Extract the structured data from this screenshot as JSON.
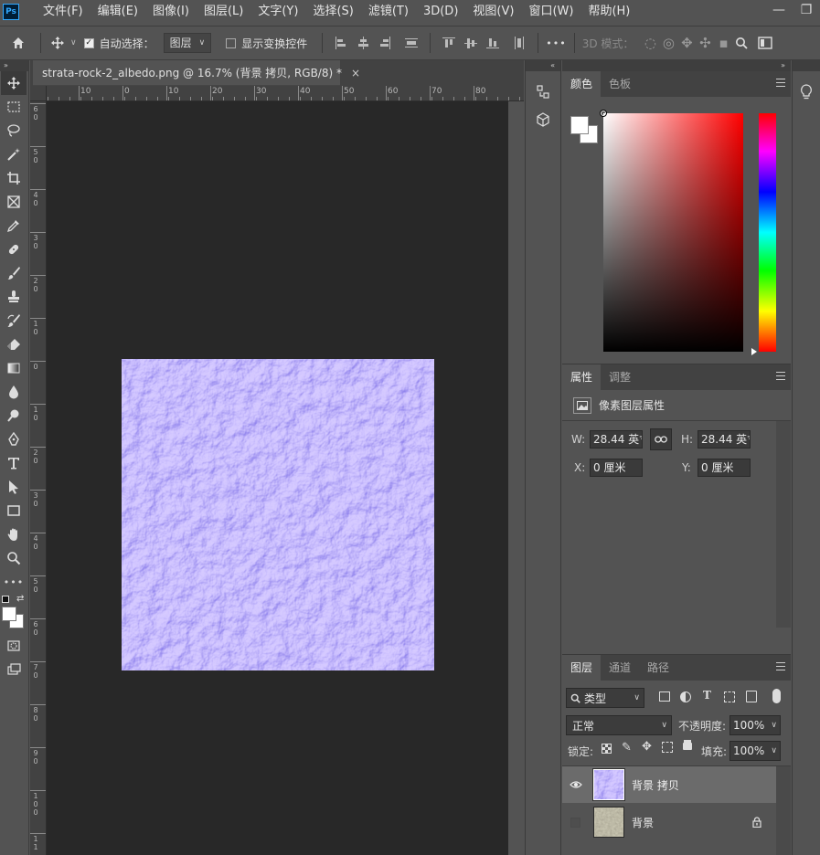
{
  "app": {
    "logo": "Ps",
    "menu": [
      "文件(F)",
      "编辑(E)",
      "图像(I)",
      "图层(L)",
      "文字(Y)",
      "选择(S)",
      "滤镜(T)",
      "3D(D)",
      "视图(V)",
      "窗口(W)",
      "帮助(H)"
    ],
    "window_controls": {
      "minimize": "—",
      "restore": "❐"
    }
  },
  "options": {
    "auto_select_label": "自动选择：",
    "auto_select_checked": true,
    "target_value": "图层",
    "show_transform_label": "显示变换控件",
    "show_transform_checked": false,
    "more": "•••",
    "mode_3d_label": "3D 模式："
  },
  "document": {
    "tab_title": "strata-rock-2_albedo.png @ 16.7% (背景 拷贝, RGB/8) *",
    "close_glyph": "×",
    "ruler_h_labels": [
      "10",
      "0",
      "10",
      "20",
      "30",
      "40",
      "50",
      "60",
      "70",
      "80"
    ],
    "ruler_v_labels": [
      "6\n0",
      "5\n0",
      "4\n0",
      "3\n0",
      "2\n0",
      "1\n0",
      "0",
      "1\n0",
      "2\n0",
      "3\n0",
      "4\n0",
      "5\n0",
      "6\n0",
      "7\n0",
      "8\n0",
      "9\n0",
      "1\n0\n0",
      "1\n1"
    ],
    "zoom": "16.7%"
  },
  "color_panel": {
    "tabs": [
      "颜色",
      "色板"
    ],
    "active_tab": 0,
    "foreground": "#ffffff",
    "background": "#ffffff"
  },
  "properties_panel": {
    "tabs": [
      "属性",
      "调整"
    ],
    "active_tab": 0,
    "heading": "像素图层属性",
    "w_label": "W:",
    "w_value": "28.44 英寸",
    "h_label": "H:",
    "h_value": "28.44 英寸",
    "x_label": "X:",
    "x_value": "0 厘米",
    "y_label": "Y:",
    "y_value": "0 厘米"
  },
  "layers_panel": {
    "tabs": [
      "图层",
      "通道",
      "路径"
    ],
    "active_tab": 0,
    "filter_kind": "类型",
    "blend_mode": "正常",
    "opacity_label": "不透明度:",
    "opacity_value": "100%",
    "lock_label": "锁定:",
    "fill_label": "填充:",
    "fill_value": "100%",
    "layers": [
      {
        "name": "背景 拷贝",
        "visible": true,
        "selected": true,
        "locked": false
      },
      {
        "name": "背景",
        "visible": false,
        "selected": false,
        "locked": true
      }
    ]
  }
}
